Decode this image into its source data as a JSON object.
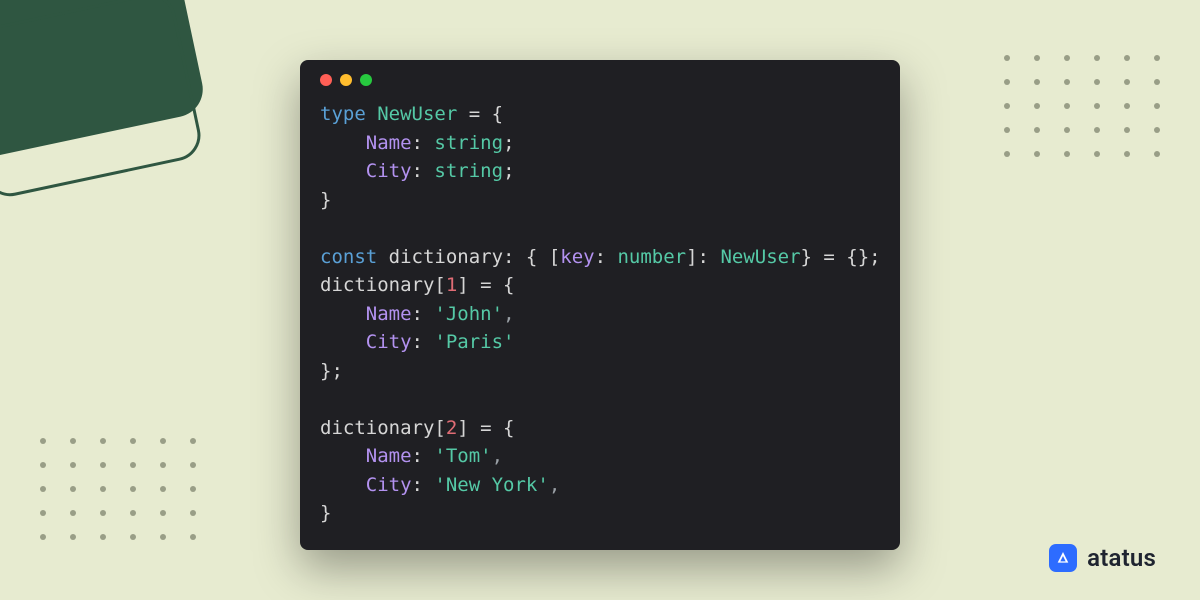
{
  "brand": {
    "name": "atatus"
  },
  "window": {
    "traffic": [
      "red",
      "yellow",
      "green"
    ]
  },
  "code": {
    "l1_kw": "type",
    "l1_type": "NewUser",
    "l1_rest": " = {",
    "l2_prop": "Name",
    "l2_type": "string",
    "l3_prop": "City",
    "l3_type": "string",
    "l4": "}",
    "l6_kw": "const",
    "l6_ident": "dictionary",
    "l6_keyprop": "key",
    "l6_keytype": "number",
    "l6_valtype": "NewUser",
    "l7_ident": "dictionary",
    "l7_idx": "1",
    "l8_prop": "Name",
    "l8_val": "'John'",
    "l9_prop": "City",
    "l9_val": "'Paris'",
    "l10": "};",
    "l12_ident": "dictionary",
    "l12_idx": "2",
    "l13_prop": "Name",
    "l13_val": "'Tom'",
    "l14_prop": "City",
    "l14_val": "'New York'",
    "l15": "}"
  }
}
